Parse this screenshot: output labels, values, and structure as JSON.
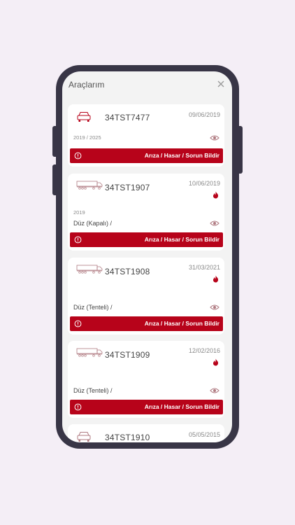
{
  "header": {
    "title": "Araçlarım"
  },
  "colors": {
    "accent": "#b7031a",
    "frame": "#383546",
    "background": "#f4eef6"
  },
  "vehicles": [
    {
      "plate": "34TST7477",
      "date": "09/06/2019",
      "years": "2019 / 2025",
      "body_type": "",
      "icon": "car-icon",
      "fire": false,
      "action_label": "Arıza / Hasar / Sorun Bildir"
    },
    {
      "plate": "34TST1907",
      "date": "10/06/2019",
      "years": "2019",
      "body_type": "Düz (Kapalı) /",
      "icon": "truck-icon",
      "fire": true,
      "action_label": "Arıza / Hasar / Sorun Bildir"
    },
    {
      "plate": "34TST1908",
      "date": "31/03/2021",
      "years": "",
      "body_type": "Düz (Tenteli) /",
      "icon": "truck-icon",
      "fire": true,
      "action_label": "Arıza / Hasar / Sorun Bildir"
    },
    {
      "plate": "34TST1909",
      "date": "12/02/2016",
      "years": "",
      "body_type": "Düz (Tenteli) /",
      "icon": "truck-icon",
      "fire": true,
      "action_label": "Arıza / Hasar / Sorun Bildir"
    },
    {
      "plate": "34TST1910",
      "date": "05/05/2015",
      "years": "",
      "body_type": "",
      "icon": "car-icon",
      "fire": false,
      "action_label": ""
    }
  ]
}
